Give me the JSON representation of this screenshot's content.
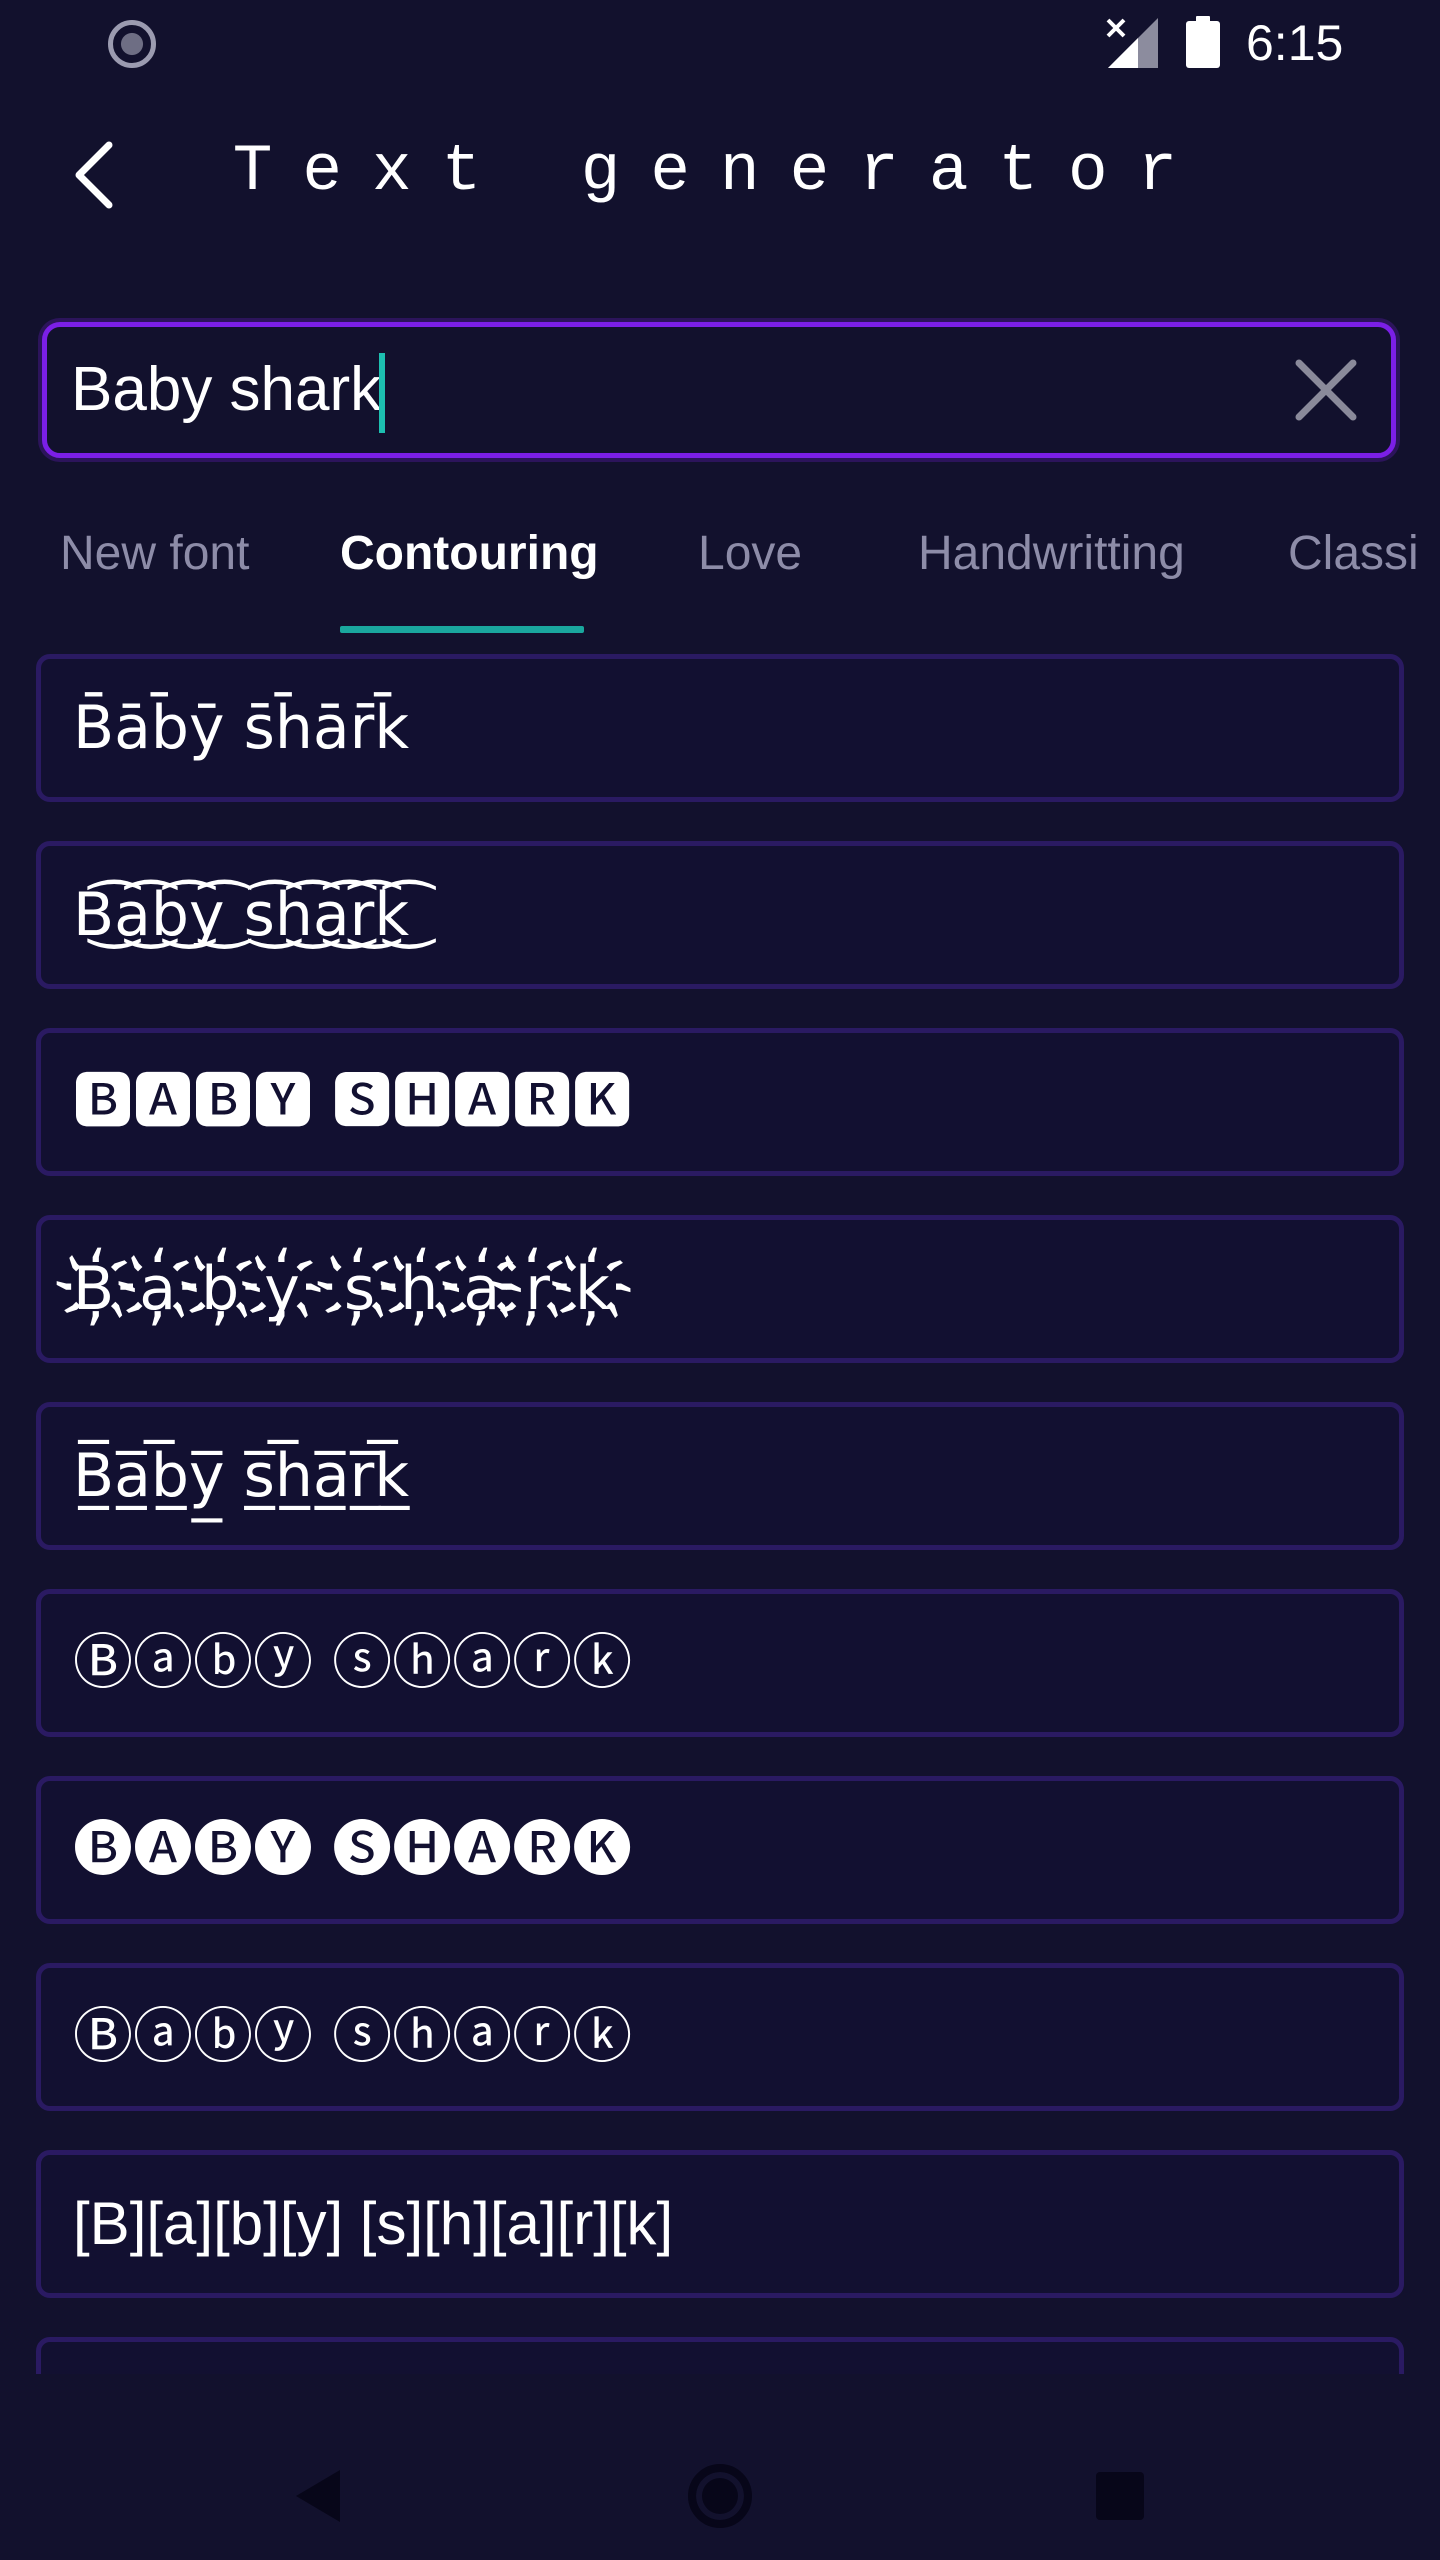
{
  "status_bar": {
    "time": "6:15",
    "icons": [
      "sync-icon",
      "signal-off-icon",
      "battery-icon"
    ]
  },
  "app_bar": {
    "title": "Text generator",
    "back_icon": "chevron-left-icon"
  },
  "search": {
    "value": "Baby shark",
    "clear_icon": "close-icon"
  },
  "tabs": [
    {
      "label": "New font",
      "active": false
    },
    {
      "label": "Contouring",
      "active": true
    },
    {
      "label": "Love",
      "active": false
    },
    {
      "label": "Handwritting",
      "active": false
    },
    {
      "label": "Classi",
      "active": false
    }
  ],
  "results": [
    {
      "text": "B̄āb̄ȳ s̄h̄ār̄k̄"
    },
    {
      "text": "B͜͡a͜͡b͜͡y͜͡ s͜͡h͜͡a͜͡r͜͡k͜͡"
    },
    {
      "text": "🅱🅰🅱🆈 🆂🅷🅰🆁🅺"
    },
    {
      "text": "B҉a҉b҉y҉ s҉h҉a҉r҉k҉"
    },
    {
      "text": "B̲̅a̲̅b̲̅y̲̅ s̲̅h̲̅a̲̅r̲̅k̲̅"
    },
    {
      "text": "Ⓑⓐⓑⓨ ⓢⓗⓐⓡⓚ"
    },
    {
      "text": "🅑🅐🅑🅨 🅢🅗🅐🅡🅚"
    },
    {
      "text": "Ⓑⓐⓑⓨ ⓢⓗⓐⓡⓚ"
    },
    {
      "text": "[B][a][b][y] [s][h][a][r][k]"
    },
    {
      "text": ""
    }
  ],
  "nav_bar": {
    "icons": [
      "nav-back-icon",
      "nav-home-icon",
      "nav-recents-icon"
    ]
  },
  "colors": {
    "background": "#12112d",
    "accent_purple": "#7b1fe6",
    "accent_teal": "#1aa79e",
    "card_border": "#2a1a62",
    "inactive_tab": "#8d8ca8"
  }
}
